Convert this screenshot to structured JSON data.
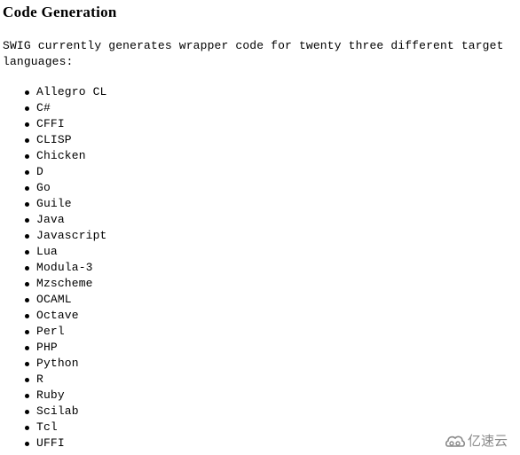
{
  "heading": "Code Generation",
  "intro": "SWIG currently generates wrapper code for twenty three different target languages:",
  "languages": [
    "Allegro CL",
    "C#",
    "CFFI",
    "CLISP",
    "Chicken",
    "D",
    "Go",
    "Guile",
    "Java",
    "Javascript",
    "Lua",
    "Modula-3",
    "Mzscheme",
    "OCAML",
    "Octave",
    "Perl",
    "PHP",
    "Python",
    "R",
    "Ruby",
    "Scilab",
    "Tcl",
    "UFFI"
  ],
  "watermark": {
    "icon": "cloud-logo-icon",
    "text": "亿速云"
  }
}
